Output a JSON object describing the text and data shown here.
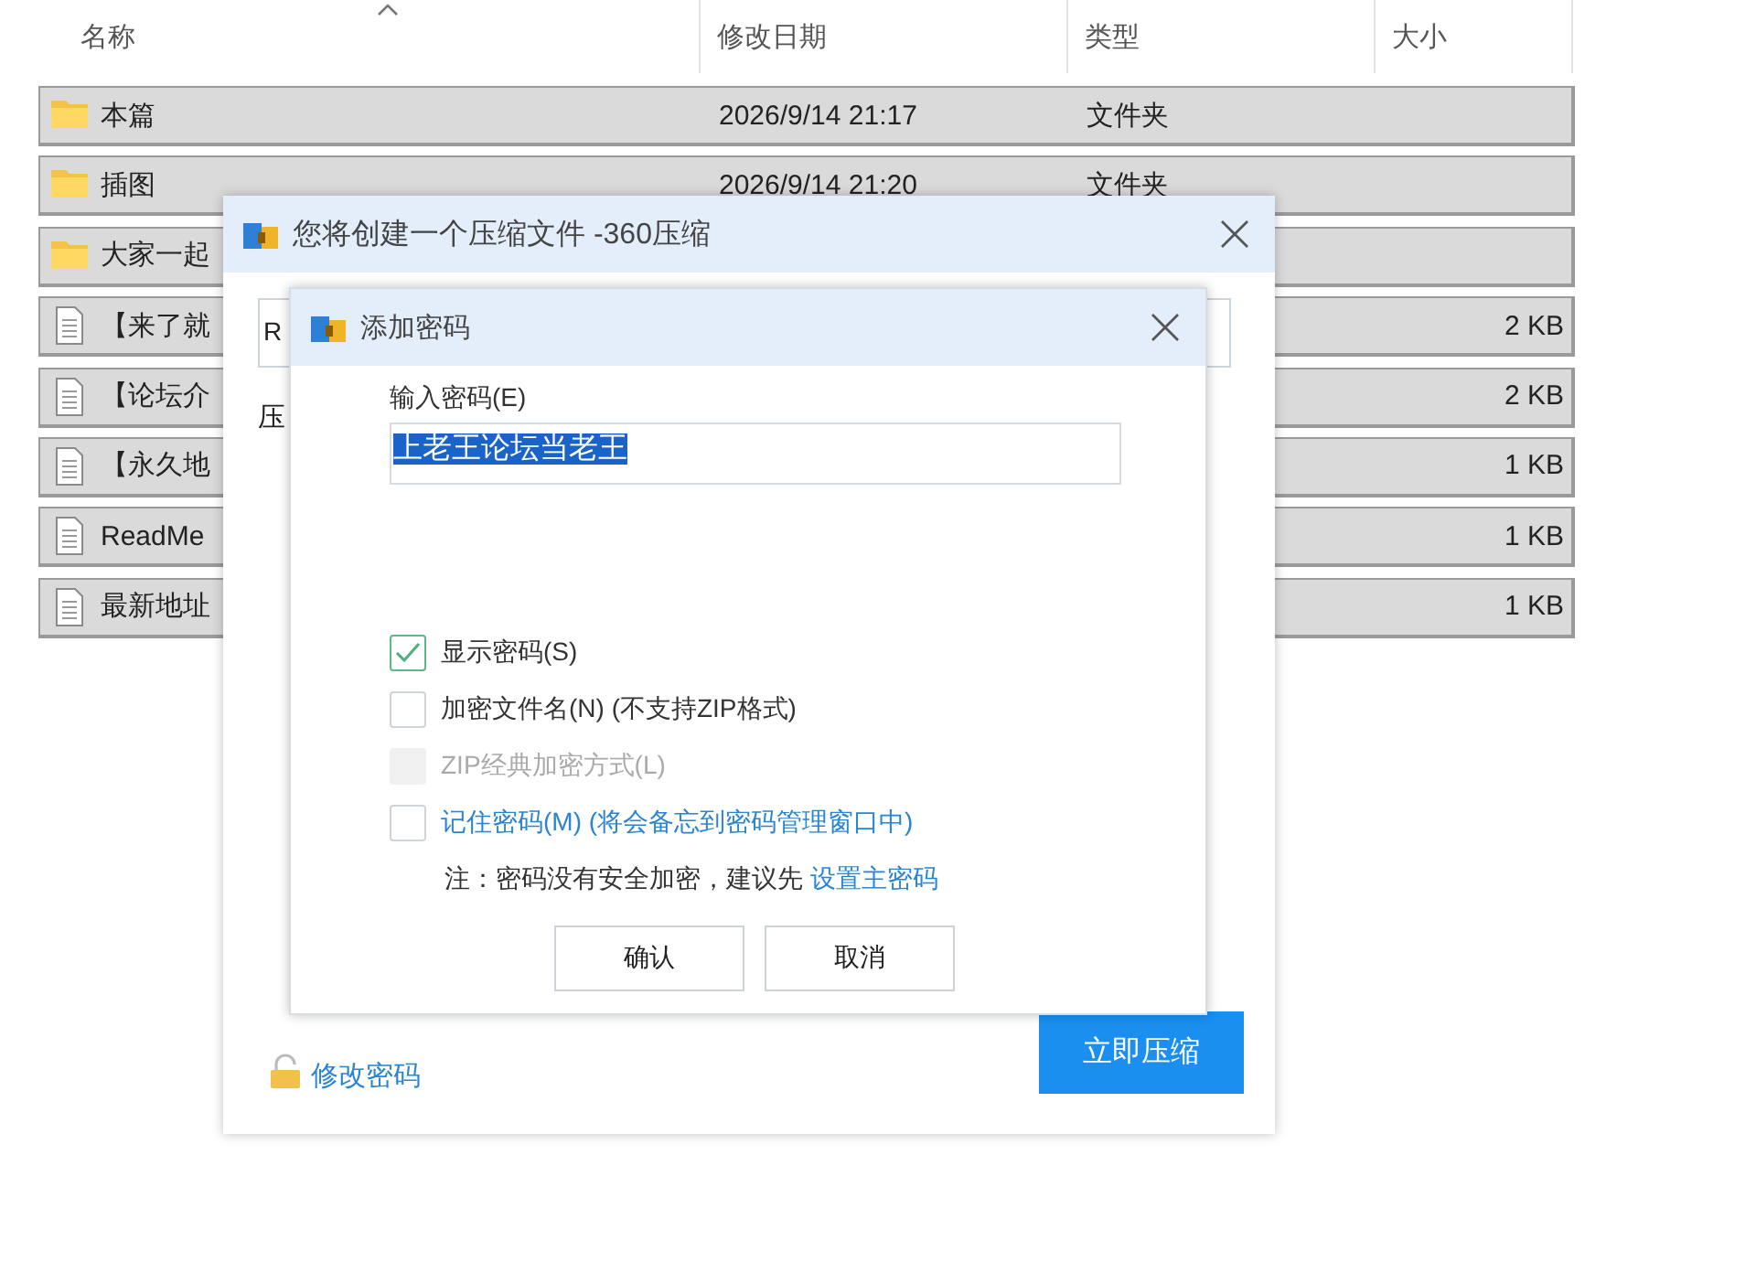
{
  "file_list": {
    "columns": [
      {
        "label": "名称",
        "sorted": true
      },
      {
        "label": "修改日期",
        "sorted": false
      },
      {
        "label": "类型",
        "sorted": false
      },
      {
        "label": "大小",
        "sorted": false
      }
    ],
    "rows": [
      {
        "kind": "folder",
        "selected": true,
        "name": "本篇",
        "date": "2026/9/14 21:17",
        "type": "文件夹"
      },
      {
        "kind": "folder",
        "selected": true,
        "name": "插图",
        "date": "2026/9/14 21:20",
        "type": "文件夹"
      },
      {
        "kind": "folder",
        "selected": true,
        "name": "大家一起"
      },
      {
        "kind": "file",
        "selected": true,
        "name": "【来了就",
        "size": "2 KB"
      },
      {
        "kind": "file",
        "selected": true,
        "name": "【论坛介",
        "size": "2 KB"
      },
      {
        "kind": "file",
        "selected": true,
        "name": "【永久地",
        "size": "1 KB"
      },
      {
        "kind": "file",
        "selected": true,
        "name": "ReadMe",
        "size": "1 KB"
      },
      {
        "kind": "file",
        "selected": true,
        "name": "最新地址",
        "size": "1 KB"
      }
    ]
  },
  "compress_window": {
    "title": "您将创建一个压缩文件 -360压缩",
    "path_value": "R",
    "label": "压",
    "change_password_link": "修改密码",
    "compress_button": "立即压缩"
  },
  "password_dialog": {
    "title": "添加密码",
    "field_label": "输入密码(E)",
    "password": "上老王论坛当老王",
    "password_selected": true,
    "options": [
      {
        "kind": "plain",
        "label": "显示密码(S)",
        "checked": true,
        "disabled": false
      },
      {
        "kind": "plain",
        "label": "加密文件名(N) (不支持ZIP格式)",
        "checked": false,
        "disabled": false
      },
      {
        "kind": "plain",
        "label": "ZIP经典加密方式(L)",
        "checked": false,
        "disabled": true
      },
      {
        "kind": "link",
        "label": "记住密码(M) (将会备忘到密码管理窗口中)",
        "checked": false,
        "disabled": false
      }
    ],
    "note": "注：密码没有安全加密，建议先",
    "note_link": "设置主密码",
    "buttons": [
      "确认",
      "取消"
    ]
  }
}
